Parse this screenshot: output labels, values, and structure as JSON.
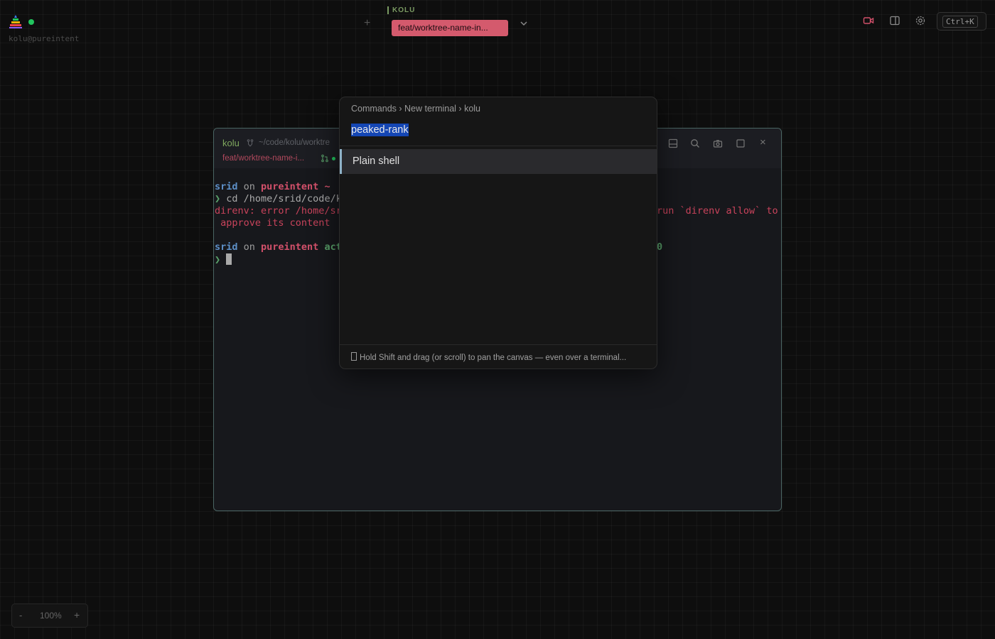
{
  "app": {
    "host_label": "kolu@pureintent",
    "status_color": "#22c55e"
  },
  "topbar": {
    "add_tab_glyph": "+",
    "workspace_label": "KOLU",
    "active_tab": "feat/worktree-name-in...",
    "chevron_icon": "chevron-down-icon",
    "icons": [
      "record-icon",
      "panel-icon",
      "gear-icon"
    ],
    "shortcut": "Ctrl+K"
  },
  "terminal": {
    "name": "kolu",
    "path": "~/code/kolu/worktre",
    "branch": "feat/worktree-name-i...",
    "header_icons": [
      "split-icon",
      "search-icon",
      "camera-icon",
      "maximize-icon",
      "close-icon"
    ],
    "close_glyph": "×",
    "lines": {
      "l1_user": "srid",
      "l1_on": " on ",
      "l1_host": "pureintent",
      "l1_tilde": " ~",
      "l2_prompt": "❯",
      "l2_cmd": " cd /home/srid/code/k",
      "l3_err": "direnv: error /home/sr",
      "l3_err_right": "run `direnv allow` to",
      "l4_err": " approve its content",
      "l5_user": "srid",
      "l5_on": " on ",
      "l5_host": "pureintent",
      "l5_act": " act",
      "l5_right": "0",
      "l6_prompt": "❯"
    }
  },
  "palette": {
    "breadcrumb": "Commands › New terminal › kolu",
    "query": "peaked-rank",
    "results": [
      {
        "label": "Plain shell"
      }
    ],
    "hint": "Hold Shift and drag (or scroll) to pan the canvas — even over a terminal..."
  },
  "zoom": {
    "minus": "-",
    "level": "100%",
    "plus": "+"
  },
  "colors": {
    "accent_pink": "#d45a6d",
    "accent_green": "#7fa75e",
    "terminal_border": "#4a6563",
    "selection_blue": "#1446b4"
  }
}
